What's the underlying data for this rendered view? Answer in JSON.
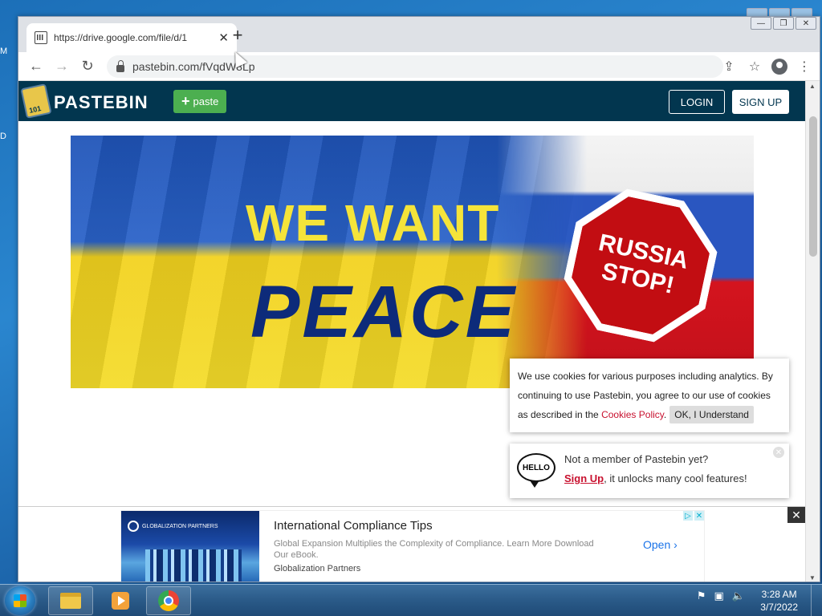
{
  "desktop": {
    "frag1": "M",
    "frag2": "D"
  },
  "browser": {
    "tab_title": "https://drive.google.com/file/d/1",
    "tab_close": "✕",
    "new_tab": "+",
    "url": "pastebin.com/fVqdW8Lp",
    "controls": {
      "minimize": "—",
      "restore": "❐",
      "close": "✕"
    }
  },
  "pastebin": {
    "logo_text": "PASTEBIN",
    "paste_button": "paste",
    "login": "LOGIN",
    "signup": "SIGN UP"
  },
  "banner": {
    "line1": "WE WANT",
    "line2": "PEACE",
    "stop_line1": "RUSSIA",
    "stop_line2": "STOP!",
    "colors": {
      "ukraine_blue": "#2a62c8",
      "ukraine_yellow": "#f4dc2a",
      "stop_red": "#c20d12"
    }
  },
  "cookie": {
    "text_before": "We use cookies for various purposes including analytics. By continuing to use Pastebin, you agree to our use of cookies as described in the",
    "link": "Cookies Policy",
    "ok_button": "OK, I Understand"
  },
  "member_popup": {
    "hello": "HELLO",
    "line1": "Not a member of Pastebin yet?",
    "signup_link": "Sign Up",
    "line2_rest": ", it unlocks many cool features!"
  },
  "ad": {
    "brand": "GLOBALIZATION PARTNERS",
    "title": "International Compliance Tips",
    "description": "Global Expansion Multiplies the Complexity of Compliance. Learn More Download Our eBook.",
    "advertiser": "Globalization Partners",
    "cta": "Open",
    "close": "✕"
  },
  "taskbar": {
    "time": "3:28 AM",
    "date": "3/7/2022"
  }
}
